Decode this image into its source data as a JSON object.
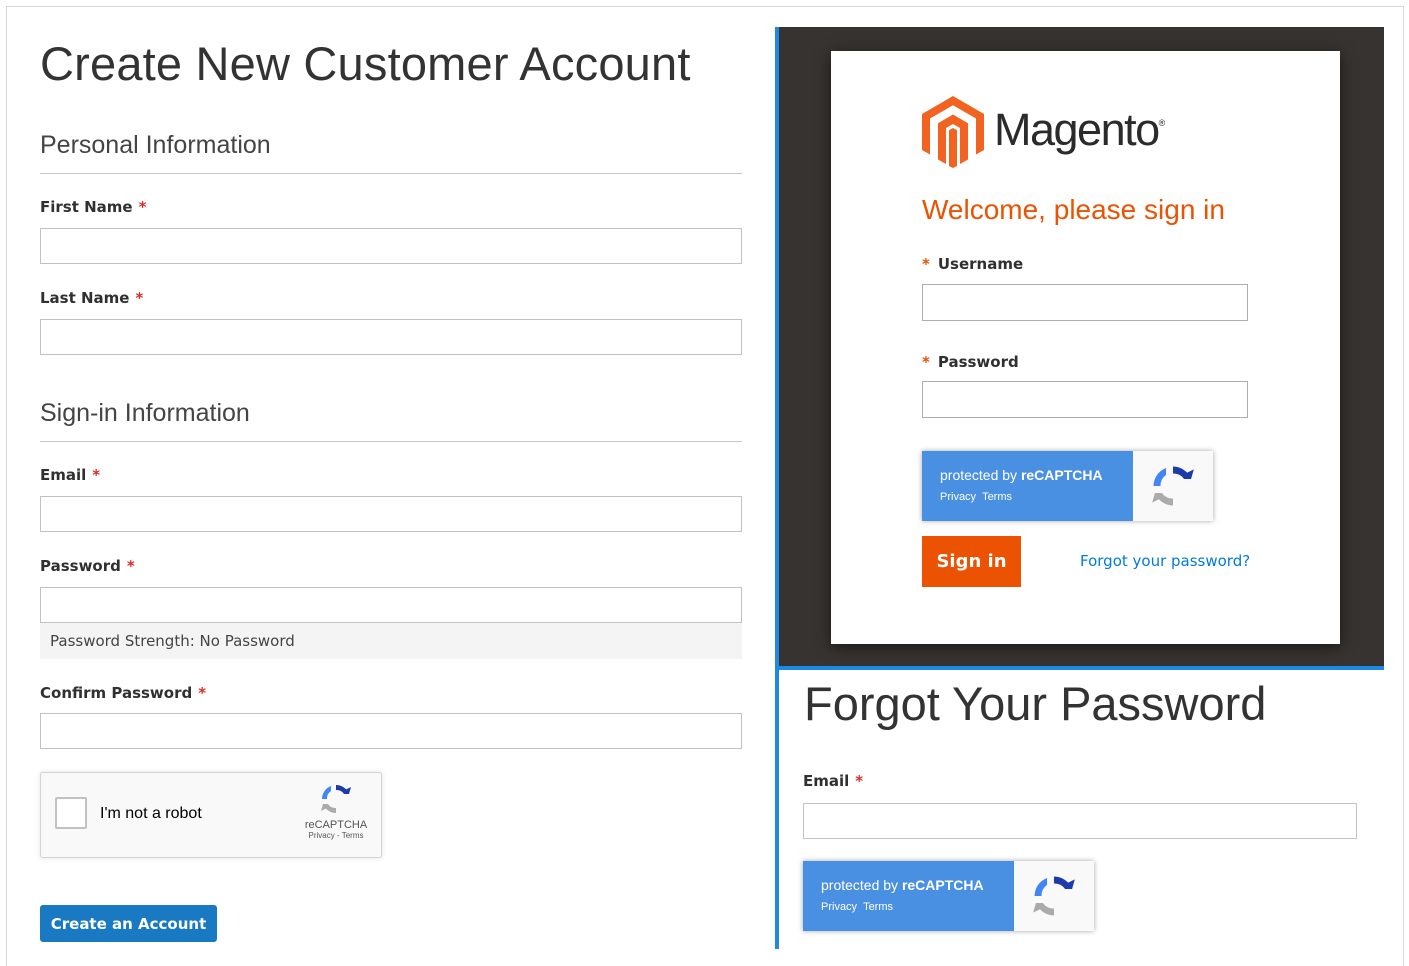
{
  "create_account": {
    "title": "Create New Customer Account",
    "personal_section": "Personal Information",
    "first_name_label": "First Name",
    "last_name_label": "Last Name",
    "signin_section": "Sign-in Information",
    "email_label": "Email",
    "password_label": "Password",
    "password_strength": "Password Strength: No Password",
    "confirm_password_label": "Confirm Password",
    "required_marker": "*",
    "submit_label": "Create an Account"
  },
  "recaptcha_checkbox": {
    "label": "I'm not a robot",
    "brand": "reCAPTCHA",
    "links": "Privacy - Terms"
  },
  "admin_login": {
    "brand": "Magento",
    "welcome": "Welcome, please sign in",
    "username_label": "Username",
    "password_label": "Password",
    "required_marker": "*",
    "signin_label": "Sign in",
    "forgot_link": "Forgot your password?",
    "brand_color": "#eb5202"
  },
  "recaptcha_badge": {
    "protected_prefix": "protected by ",
    "protected_brand": "reCAPTCHA",
    "privacy": "Privacy",
    "terms": "Terms"
  },
  "forgot_password": {
    "title": "Forgot Your Password",
    "email_label": "Email",
    "required_marker": "*"
  },
  "colors": {
    "primary_button": "#1979c3",
    "required": "#e02b27",
    "accent_blue": "#1e88e5",
    "link": "#007bdb"
  }
}
